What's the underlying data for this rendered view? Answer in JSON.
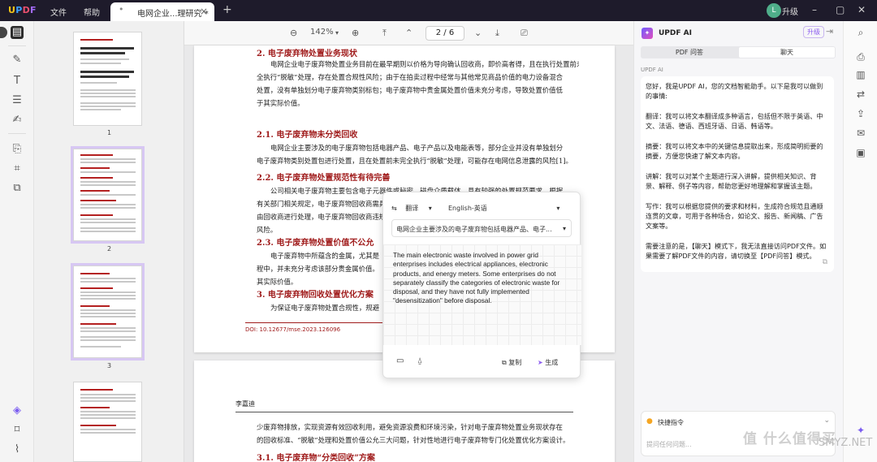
{
  "app": {
    "logo": "UPDF",
    "menu_file": "文件",
    "menu_help": "帮助",
    "tab_title": "电网企业...理研究 *",
    "upgrade": "升级",
    "avatar": "L"
  },
  "colors": {
    "accent": "#8c5cf0",
    "heading_red": "#a01c1c",
    "titlebar": "#1e1b2b"
  },
  "doc_toolbar": {
    "zoom": "142%",
    "page_current": "2",
    "page_total": "6",
    "page_display": "2 / 6"
  },
  "thumbnails": [
    {
      "label": "1"
    },
    {
      "label": "2"
    },
    {
      "label": "3"
    }
  ],
  "page1": {
    "h2": "2.  电子废弃物处置业务现状",
    "p1": [
      "电网企业电子废弃物处置业务目前在最早期则以价格为导向确认回收商，即价高者得，且在执行处置前未",
      "全执行“脱敏”处理，存在处置合规性风险；由于在拍卖过程中经常与其他常见商品价值的电力设备混合",
      "处置，没有单独划分电子废弃物类别标包；电子废弃物中贵金属处置价值未充分考虑，导致处置价值低",
      "于其实际价值。"
    ],
    "h21": "2.1.  电子废弃物未分类回收",
    "p2": [
      "电网企业主要涉及的电子废弃物包括电器产品、电子产品以及电能表等，部分企业并没有单独划分",
      "电子废弃物类别处置包进行处置，且在处置前未完全执行“脱敏”处理，可能存在电网信息泄露的风险[1]。"
    ],
    "h22": "2.2.  电子废弃物处置规范性有待完善",
    "p3": [
      "公司相关电子废弃物主要包含电子元器件或秘密、磁盘介质载体，具有较强的处置规范要求。根据",
      "有关部门相关规定，电子废弃物回收商需具备一定的资质，而部分企业主要通过附加处置的方式廉价交",
      "由回收商进行处理，电子废弃物回收商违规处理问题，其主要在电网信息泄露问题，事实处置的国家规",
      "风险。"
    ],
    "h23": "2.3.  电子废弃物处置价值不公允",
    "p4": [
      "电子废弃物中所蕴含的金属，尤其是",
      "程中，并未充分考虑该部分贵金属价值。",
      "其实际价值。"
    ],
    "h3": "3.  电子废弃物回收处置优化方案",
    "p5": [
      "为保证电子废弃物处置合规性，规避"
    ],
    "doi": "DOI: 10.12677/mse.2023.126096"
  },
  "page2": {
    "author": "李嘉迪",
    "p1": [
      "少废弃物排放，实现资源有效回收利用，避免资源浪费和环境污染，针对电子废弃物处置业务现状存在",
      "的回收标准、“脱敏”处理和处置价值公允三大问题，针对性地进行电子废弃物专门化处置优化方案设计。"
    ],
    "h31": "3.1.  电子废弃物“分类回收”方案"
  },
  "translate_popup": {
    "mode": "翻译",
    "language": "English-英语",
    "source": "电网企业主要涉及的电子废弃物包括电器产品、电子...",
    "output": "The main electronic waste involved in power grid enterprises includes electrical appliances, electronic products, and energy meters. Some enterprises do not separately classify the categories of electronic waste for disposal, and they have not fully implemented \"desensitization\" before disposal.",
    "copy": "复制",
    "generate": "生成"
  },
  "ai_panel": {
    "title": "UPDF AI",
    "upgrade": "升级",
    "tab_pdf": "PDF 问答",
    "tab_chat": "聊天",
    "section_label": "UPDF AI",
    "messages": [
      "您好，我是UPDF AI，您的文档智能助手。以下是我可以做到的事情:",
      "翻译：我可以将文本翻译成多种语言，包括但不限于英语、中文、法语、德语、西班牙语、日语、韩语等。",
      "摘要：我可以将文本中的关键信息提取出来，形成简明扼要的摘要，方便您快速了解文本内容。",
      "讲解：我可以对某个主题进行深入讲解，提供相关知识、背景、解释、例子等内容，帮助您更好地理解和掌握该主题。",
      "写作：我可以根据您提供的要求和材料，生成符合规范且通顺连贯的文章，可用于各种场合，如论文、报告、新闻稿、广告文案等。",
      "需要注意的是，【聊天】模式下，我无法直接访问PDF文件。如果需要了解PDF文件的内容，请切换至【PDF问答】模式。"
    ],
    "quick_cmd": "快捷指令",
    "input_placeholder": "提问任何问题..."
  },
  "watermark": {
    "main": "值 什么值得买",
    "sub": "SMYZ.NET"
  }
}
